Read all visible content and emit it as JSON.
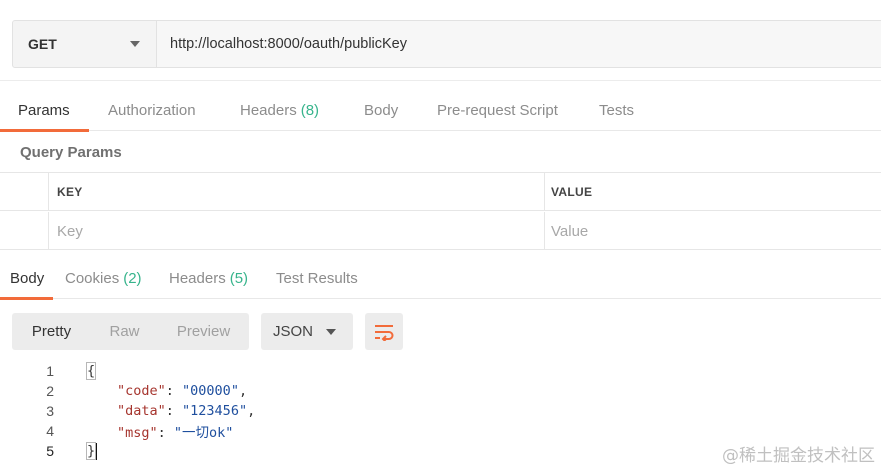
{
  "request": {
    "method": "GET",
    "url": "http://localhost:8000/oauth/publicKey"
  },
  "request_tabs": [
    {
      "label": "Params",
      "count": "",
      "active": true
    },
    {
      "label": "Authorization",
      "count": ""
    },
    {
      "label": "Headers",
      "count": "(8)"
    },
    {
      "label": "Body",
      "count": ""
    },
    {
      "label": "Pre-request Script",
      "count": ""
    },
    {
      "label": "Tests",
      "count": ""
    }
  ],
  "params": {
    "title": "Query Params",
    "columns": [
      "KEY",
      "VALUE"
    ],
    "key_placeholder": "Key",
    "value_placeholder": "Value"
  },
  "response_tabs": [
    {
      "label": "Body",
      "count": "",
      "active": true
    },
    {
      "label": "Cookies",
      "count": "(2)"
    },
    {
      "label": "Headers",
      "count": "(5)"
    },
    {
      "label": "Test Results",
      "count": ""
    }
  ],
  "view_modes": [
    "Pretty",
    "Raw",
    "Preview"
  ],
  "format": "JSON",
  "body_lines": [
    {
      "n": "1",
      "text": "{"
    },
    {
      "n": "2",
      "key": "\"code\"",
      "value": "\"00000\"",
      "trail": ","
    },
    {
      "n": "3",
      "key": "\"data\"",
      "value": "\"123456\"",
      "trail": ","
    },
    {
      "n": "4",
      "key": "\"msg\"",
      "value": "\"一切ok\"",
      "trail": ""
    },
    {
      "n": "5",
      "text": "}"
    }
  ],
  "watermark": "@稀土掘金技术社区",
  "colors": {
    "accent": "#f26b3a",
    "count": "#37b48c",
    "json_key": "#a6352e",
    "json_string": "#1f4f9e"
  }
}
